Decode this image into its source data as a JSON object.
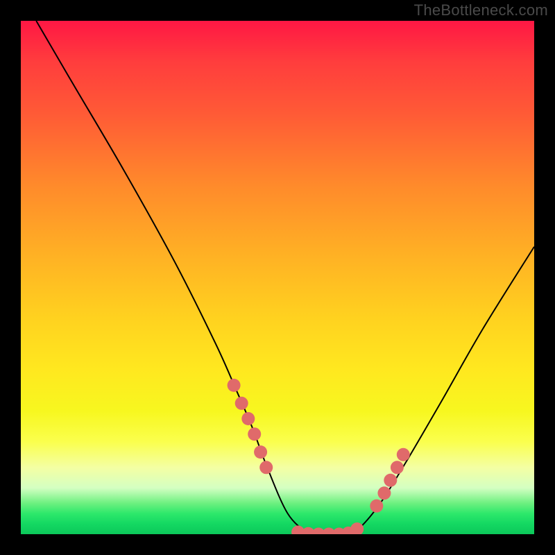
{
  "watermark": {
    "text": "TheBottleneck.com"
  },
  "chart_data": {
    "type": "line",
    "title": "",
    "xlabel": "",
    "ylabel": "",
    "xlim": [
      0,
      100
    ],
    "ylim": [
      0,
      100
    ],
    "series": [
      {
        "name": "curve",
        "x": [
          3,
          10,
          20,
          30,
          38,
          42,
          45,
          48,
          52,
          56,
          58,
          60,
          62,
          64,
          66,
          70,
          75,
          82,
          90,
          100
        ],
        "y": [
          100,
          88,
          71,
          53,
          37,
          28,
          21,
          13,
          4,
          0.2,
          0,
          0,
          0,
          0.2,
          1.2,
          6,
          14,
          26,
          40,
          56
        ]
      },
      {
        "name": "dots-left",
        "x": [
          41.5,
          43,
          44.3,
          45.5,
          46.7,
          47.8
        ],
        "y": [
          29,
          25.5,
          22.5,
          19.5,
          16,
          13
        ]
      },
      {
        "name": "dots-bottom",
        "x": [
          54,
          56,
          58,
          60,
          62,
          63.8,
          65.5
        ],
        "y": [
          0.4,
          0.1,
          0,
          0,
          0,
          0.2,
          1.0
        ]
      },
      {
        "name": "dots-right",
        "x": [
          69.3,
          70.8,
          72,
          73.3,
          74.5
        ],
        "y": [
          5.5,
          8,
          10.5,
          13,
          15.5
        ]
      }
    ],
    "colors": {
      "curve": "#000000",
      "dots": "#e06a6a"
    }
  }
}
